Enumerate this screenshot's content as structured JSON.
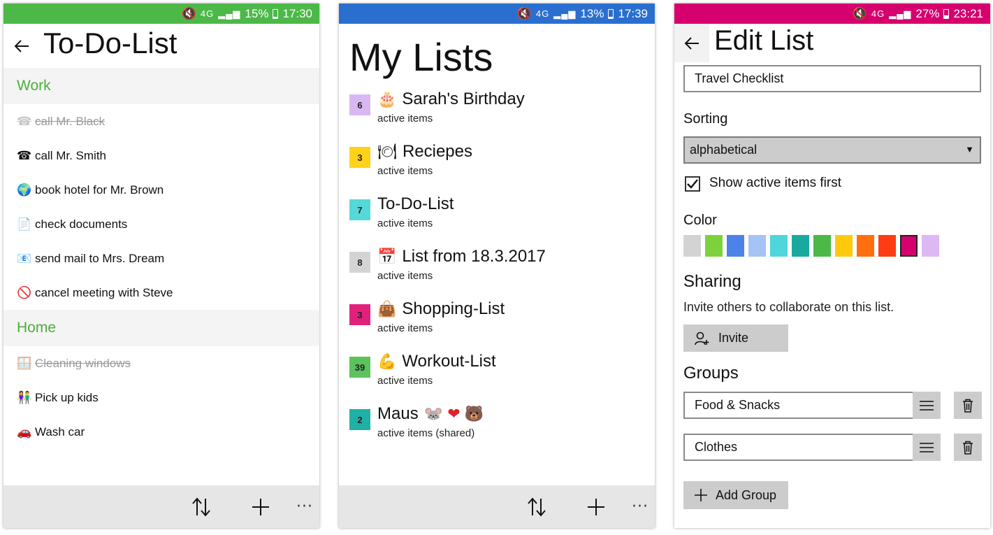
{
  "screens": {
    "todo": {
      "status": {
        "signal": "4G",
        "battery": "15%",
        "battery_level": 0.15,
        "time": "17:30",
        "color": "#4cb848"
      },
      "title": "To-Do-List",
      "accent": "#4cae3c",
      "groups": [
        {
          "name": "Work",
          "items": [
            {
              "icon": "telephone-icon",
              "glyph": "☎",
              "text": "call Mr. Black",
              "done": true
            },
            {
              "icon": "telephone-icon",
              "glyph": "☎",
              "text": "call Mr. Smith",
              "done": false
            },
            {
              "icon": "globe-icon",
              "glyph": "🌍",
              "text": "book hotel for Mr. Brown",
              "done": false
            },
            {
              "icon": "document-icon",
              "glyph": "📄",
              "text": "check documents",
              "done": false
            },
            {
              "icon": "email-icon",
              "glyph": "📧",
              "text": "send mail to Mrs. Dream",
              "done": false
            },
            {
              "icon": "prohibited-icon",
              "glyph": "🚫",
              "text": "cancel meeting with Steve",
              "done": false
            }
          ]
        },
        {
          "name": "Home",
          "items": [
            {
              "icon": "window-icon",
              "glyph": "🪟",
              "text": "Cleaning windows",
              "done": true
            },
            {
              "icon": "kids-icon",
              "glyph": "👫",
              "text": "Pick up kids",
              "done": false
            },
            {
              "icon": "car-icon",
              "glyph": "🚗",
              "text": "Wash car",
              "done": false
            }
          ]
        }
      ],
      "more_label": "···"
    },
    "lists": {
      "status": {
        "signal": "4G",
        "battery": "13%",
        "battery_level": 0.13,
        "time": "17:39",
        "color": "#2a6fd0"
      },
      "title": "My Lists",
      "items": [
        {
          "count": "6",
          "color": "#d9b8f2",
          "icon": "birthday-cake-icon",
          "glyph": "🎂",
          "name": "Sarah's Birthday",
          "sub": "active items"
        },
        {
          "count": "3",
          "color": "#ffd21a",
          "icon": "plate-icon",
          "glyph": "🍽",
          "name": "Reciepes",
          "sub": "active items"
        },
        {
          "count": "7",
          "color": "#55d8d8",
          "icon": "",
          "glyph": "",
          "name": "To-Do-List",
          "sub": "active items"
        },
        {
          "count": "8",
          "color": "#d4d4d4",
          "icon": "calendar-icon",
          "glyph": "📅",
          "name": "List from 18.3.2017",
          "sub": "active items"
        },
        {
          "count": "3",
          "color": "#e0217c",
          "icon": "handbag-icon",
          "glyph": "👜",
          "name": "Shopping-List",
          "sub": "active items"
        },
        {
          "count": "39",
          "color": "#5cc35c",
          "icon": "flexed-biceps-icon",
          "glyph": "💪",
          "name": "Workout-List",
          "sub": "active items"
        },
        {
          "count": "2",
          "color": "#1fb0a6",
          "icon": "mouse-heart-bear-icon",
          "glyph": "🐭 ❤ 🐻",
          "name": "Maus",
          "sub": "active items (shared)"
        }
      ],
      "more_label": "···"
    },
    "edit": {
      "status": {
        "signal": "4G",
        "battery": "27%",
        "battery_level": 0.27,
        "time": "23:21",
        "color": "#d6006e"
      },
      "title": "Edit List",
      "name_value": "Travel Checklist",
      "sorting_label": "Sorting",
      "sorting_value": "alphabetical",
      "show_active_label": "Show active items first",
      "show_active_checked": true,
      "color_label": "Color",
      "colors": [
        "#d3d3d3",
        "#7dd23c",
        "#4d82e8",
        "#a6c3f5",
        "#4fd6dc",
        "#1aa99e",
        "#4cb848",
        "#ffc90e",
        "#ff6f10",
        "#ff3c14",
        "#d6006e",
        "#dcb8f5"
      ],
      "selected_color": "#d6006e",
      "sharing_label": "Sharing",
      "sharing_desc": "Invite others to collaborate on this list.",
      "invite_label": "Invite",
      "groups_label": "Groups",
      "groups": [
        "Food & Snacks",
        "Clothes"
      ],
      "add_group_label": "Add Group"
    }
  }
}
